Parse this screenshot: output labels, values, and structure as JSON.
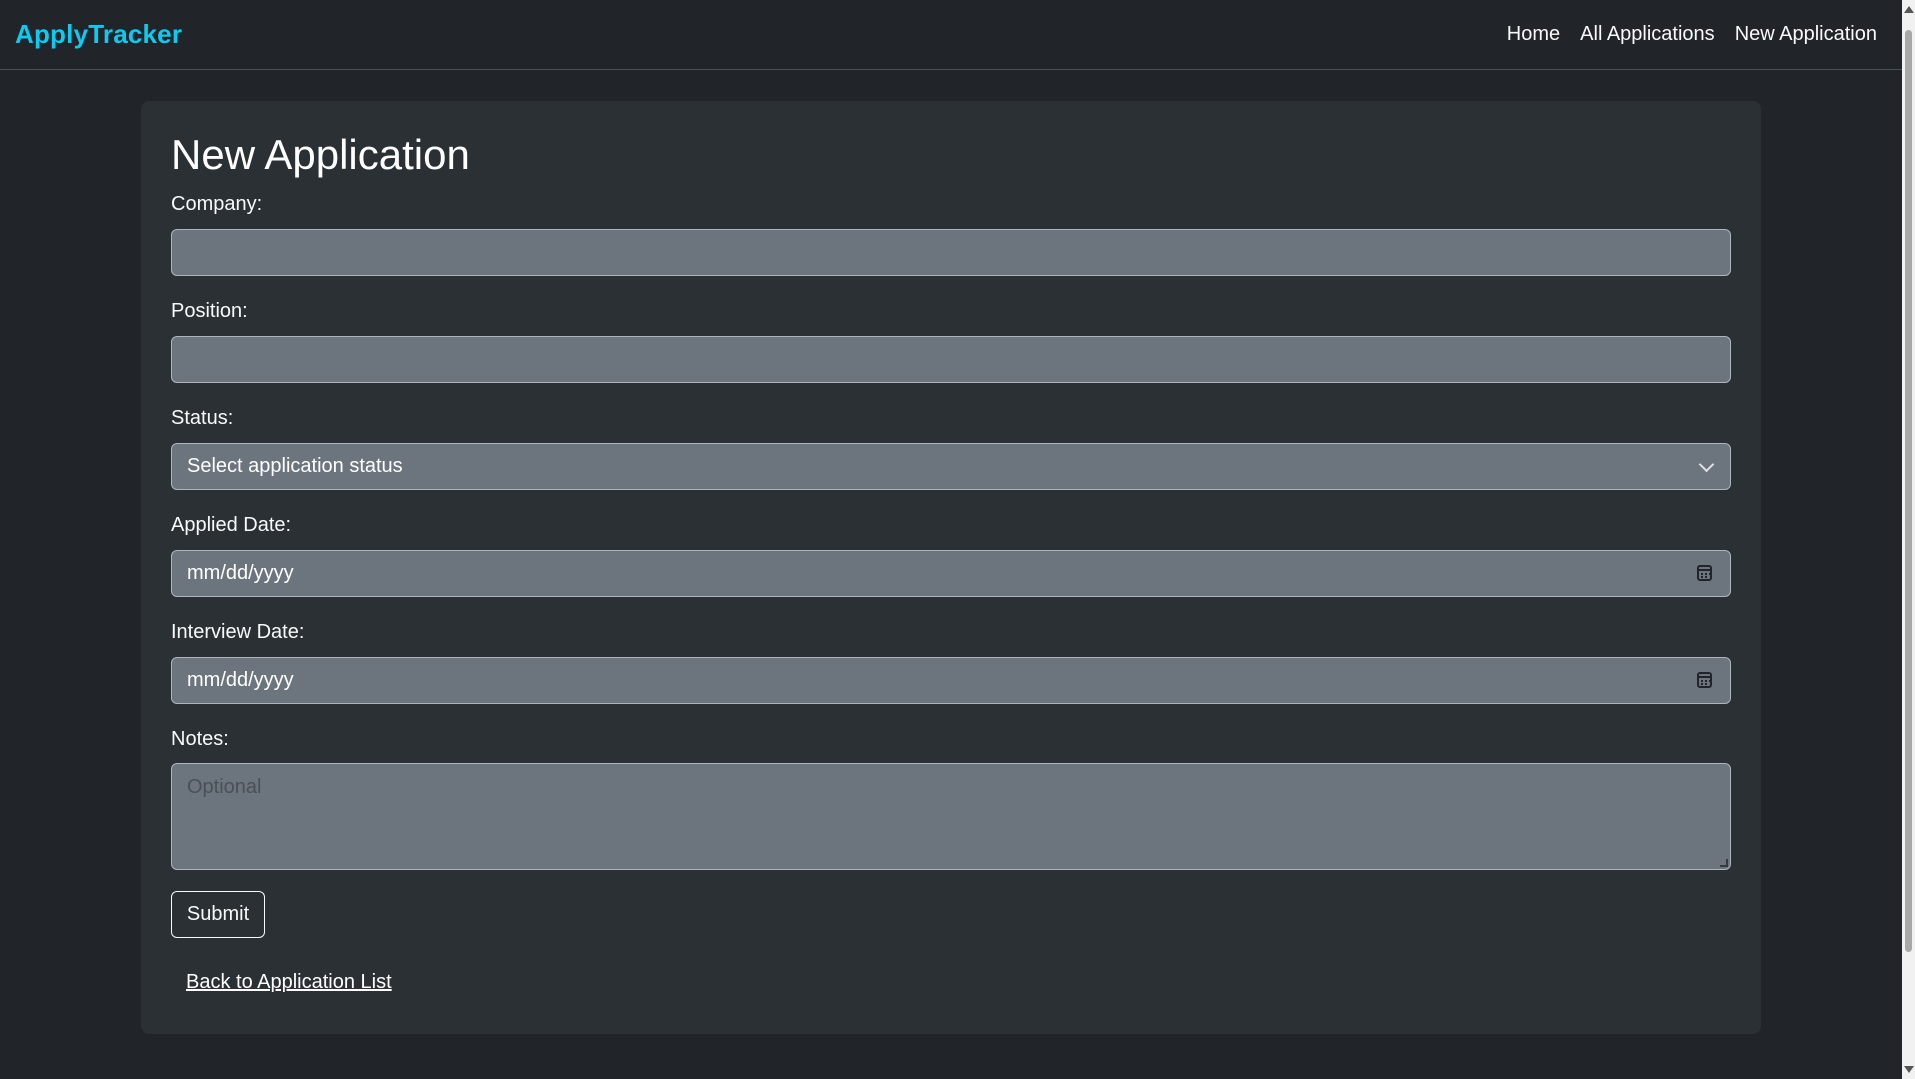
{
  "navbar": {
    "brand": "ApplyTracker",
    "links": [
      "Home",
      "All Applications",
      "New Application"
    ]
  },
  "form": {
    "title": "New Application",
    "company_label": "Company:",
    "company_value": "",
    "position_label": "Position:",
    "position_value": "",
    "status_label": "Status:",
    "status_selected": "Select application status",
    "applied_label": "Applied Date:",
    "applied_placeholder": "mm/dd/yyyy",
    "interview_label": "Interview Date:",
    "interview_placeholder": "mm/dd/yyyy",
    "notes_label": "Notes:",
    "notes_placeholder": "Optional",
    "submit_label": "Submit",
    "back_link": "Back to Application List"
  },
  "colors": {
    "background": "#212529",
    "card": "#2b3035",
    "brand": "#0dcaf0",
    "input": "#6c757d"
  },
  "icons": [
    "chevron-down-icon",
    "calendar-icon"
  ]
}
